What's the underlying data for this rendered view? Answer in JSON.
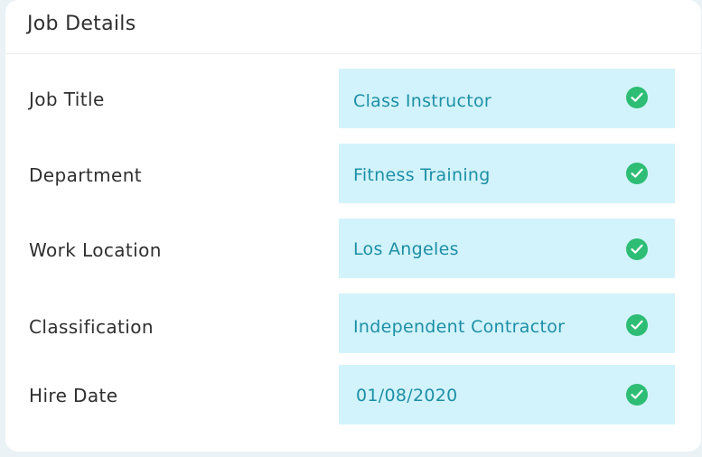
{
  "card": {
    "title": "Job Details"
  },
  "fields": [
    {
      "label": "Job Title",
      "value": "Class Instructor",
      "status_icon": "check-circle-icon"
    },
    {
      "label": "Department",
      "value": "Fitness Training",
      "status_icon": "check-circle-icon"
    },
    {
      "label": "Work Location",
      "value": "Los Angeles",
      "status_icon": "check-circle-icon"
    },
    {
      "label": "Classification",
      "value": "Independent Contractor",
      "status_icon": "check-circle-icon"
    },
    {
      "label": "Hire Date",
      "value": "01/08/2020",
      "status_icon": "check-circle-icon"
    }
  ],
  "colors": {
    "value_background": "#d2f3fb",
    "value_text": "#1d8fa6",
    "check": "#2dbd74"
  }
}
